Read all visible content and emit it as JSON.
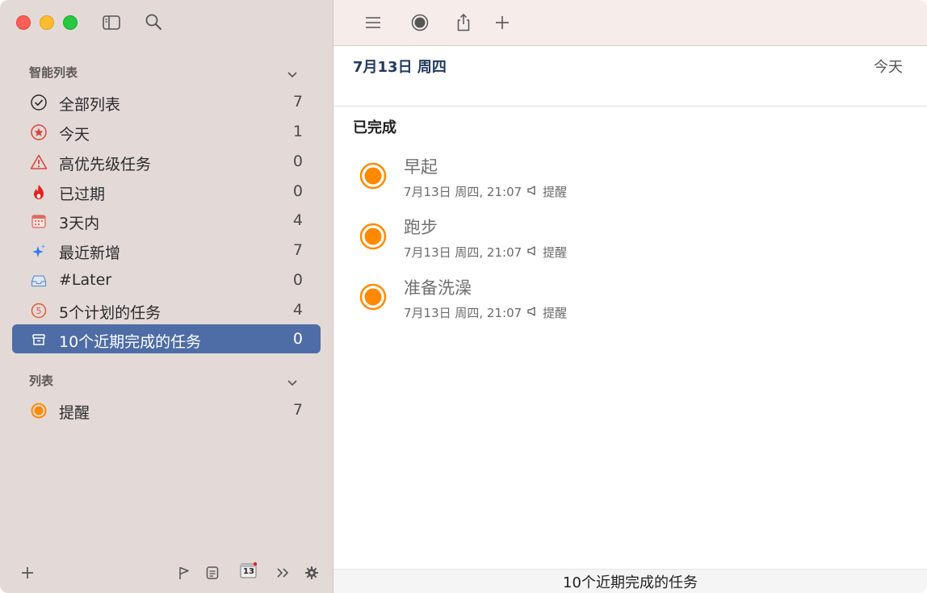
{
  "sidebar": {
    "smart_lists_header": "智能列表",
    "lists_header": "列表",
    "smart_items": [
      {
        "label": "全部列表",
        "count": "7",
        "icon": "check-circle-icon"
      },
      {
        "label": "今天",
        "count": "1",
        "icon": "star-circle-icon"
      },
      {
        "label": "高优先级任务",
        "count": "0",
        "icon": "warning-icon"
      },
      {
        "label": "已过期",
        "count": "0",
        "icon": "flame-icon"
      },
      {
        "label": "3天内",
        "count": "4",
        "icon": "calendar-icon"
      },
      {
        "label": "最近新增",
        "count": "7",
        "icon": "sparkles-icon"
      },
      {
        "label": "#Later",
        "count": "0",
        "icon": "tray-icon"
      },
      {
        "label": "5个计划的任务",
        "count": "4",
        "icon": "number-five-icon"
      },
      {
        "label": "10个近期完成的任务",
        "count": "0",
        "icon": "archive-icon"
      }
    ],
    "lists": [
      {
        "label": "提醒",
        "count": "7",
        "color": "#ff8a00"
      }
    ],
    "calendar_badge": "13"
  },
  "main": {
    "date_header": "7月13日 周四",
    "today_link": "今天",
    "section_title": "已完成",
    "tasks": [
      {
        "title": "早起",
        "meta_date": "7月13日 周四, 21:07",
        "meta_list": "提醒"
      },
      {
        "title": "跑步",
        "meta_date": "7月13日 周四, 21:07",
        "meta_list": "提醒"
      },
      {
        "title": "准备洗澡",
        "meta_date": "7月13日 周四, 21:07",
        "meta_list": "提醒"
      }
    ],
    "status_bar": "10个近期完成的任务"
  },
  "colors": {
    "accent": "#4e6ca5",
    "task_orange": "#ff8a00",
    "sidebar_bg": "#e3dad8"
  }
}
